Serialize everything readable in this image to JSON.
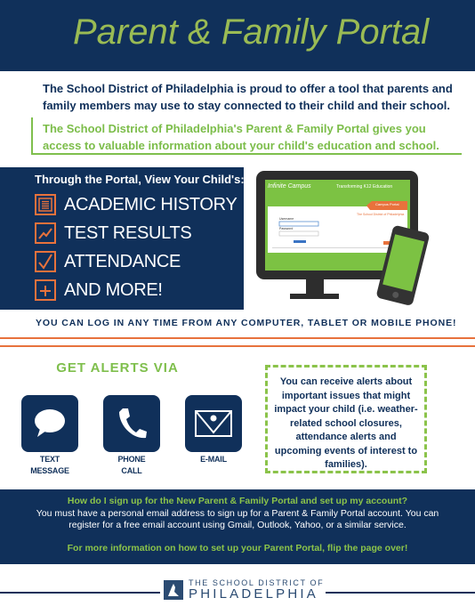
{
  "header": {
    "title": "Parent & Family Portal"
  },
  "intro": {
    "text": "The School District of Philadelphia is proud to offer a tool that parents and family members may use to stay connected to their child and their school.",
    "callout": "The School District of Philadelphia's Parent & Family Portal gives you access to valuable information about your child's education and school."
  },
  "features": {
    "heading": "Through the Portal, View Your Child's:",
    "items": [
      {
        "label": "ACADEMIC HISTORY",
        "icon": "document-icon"
      },
      {
        "label": "TEST RESULTS",
        "icon": "line-chart-icon"
      },
      {
        "label": "ATTENDANCE",
        "icon": "checkmark-icon"
      },
      {
        "label": "AND MORE!",
        "icon": "plus-icon"
      }
    ]
  },
  "devices": {
    "brand": "Infinite Campus",
    "tagline": "Transforming K12 Education",
    "portal_tab": "Campus Portal",
    "district": "The School District of Philadelphia",
    "username_label": "Username",
    "password_label": "Password",
    "sign_in": "Sign In"
  },
  "login_note": "YOU CAN LOG IN ANY TIME FROM ANY COMPUTER, TABLET OR MOBILE PHONE!",
  "alerts": {
    "title": "GET ALERTS VIA",
    "channels": [
      {
        "line1": "TEXT",
        "line2": "MESSAGE",
        "icon": "speech-bubble-icon"
      },
      {
        "line1": "PHONE",
        "line2": "CALL",
        "icon": "phone-icon"
      },
      {
        "line1": "E-MAIL",
        "line2": "",
        "icon": "envelope-icon"
      }
    ],
    "description": "You can receive alerts about important issues that might impact your child (i.e. weather-related school closures, attendance alerts and upcoming events of interest to families)."
  },
  "signup": {
    "question": "How do I sign up for the New Parent & Family Portal and set up my account?",
    "answer": "You must have a personal email address to sign up for a Parent & Family Portal account. You can register for a free email account using Gmail, Outlook, Yahoo, or a similar service.",
    "more": "For more information on how to set up your Parent Portal, flip the page over!"
  },
  "footer": {
    "logo_line1": "THE SCHOOL DISTRICT OF",
    "logo_line2": "PHILADELPHIA"
  },
  "colors": {
    "navy": "#10305a",
    "green": "#8bc34a",
    "title_green": "#9abb54",
    "orange": "#e8723c"
  }
}
